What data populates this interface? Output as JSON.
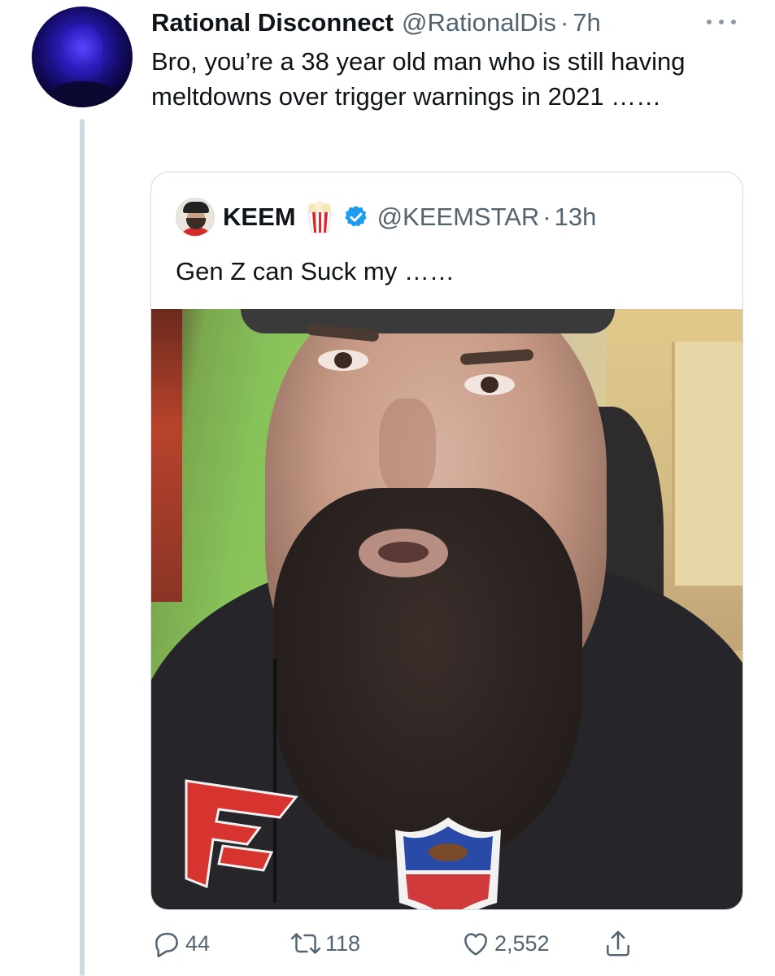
{
  "tweet": {
    "display_name": "Rational Disconnect",
    "handle": "@RationalDis",
    "separator": "·",
    "time": "7h",
    "text": "Bro, you’re a 38 year old man who is still having meltdowns over trigger warnings in 2021 ……",
    "avatar_icon": "profile-avatar-icon"
  },
  "quoted_tweet": {
    "display_name": "KEEM",
    "emoji_icon": "popcorn-icon",
    "verified_icon": "verified-badge-icon",
    "handle": "@KEEMSTAR",
    "separator": "·",
    "time": "13h",
    "text": "Gen Z can Suck my ……",
    "media": "video-thumbnail"
  },
  "actions": {
    "reply_count": "44",
    "retweet_count": "118",
    "like_count": "2,552",
    "icons": [
      "reply-icon",
      "retweet-icon",
      "like-icon",
      "share-icon"
    ]
  },
  "colors": {
    "text": "#0f1419",
    "secondary": "#536471",
    "border": "#cfd9de",
    "verified": "#1d9bf0"
  }
}
